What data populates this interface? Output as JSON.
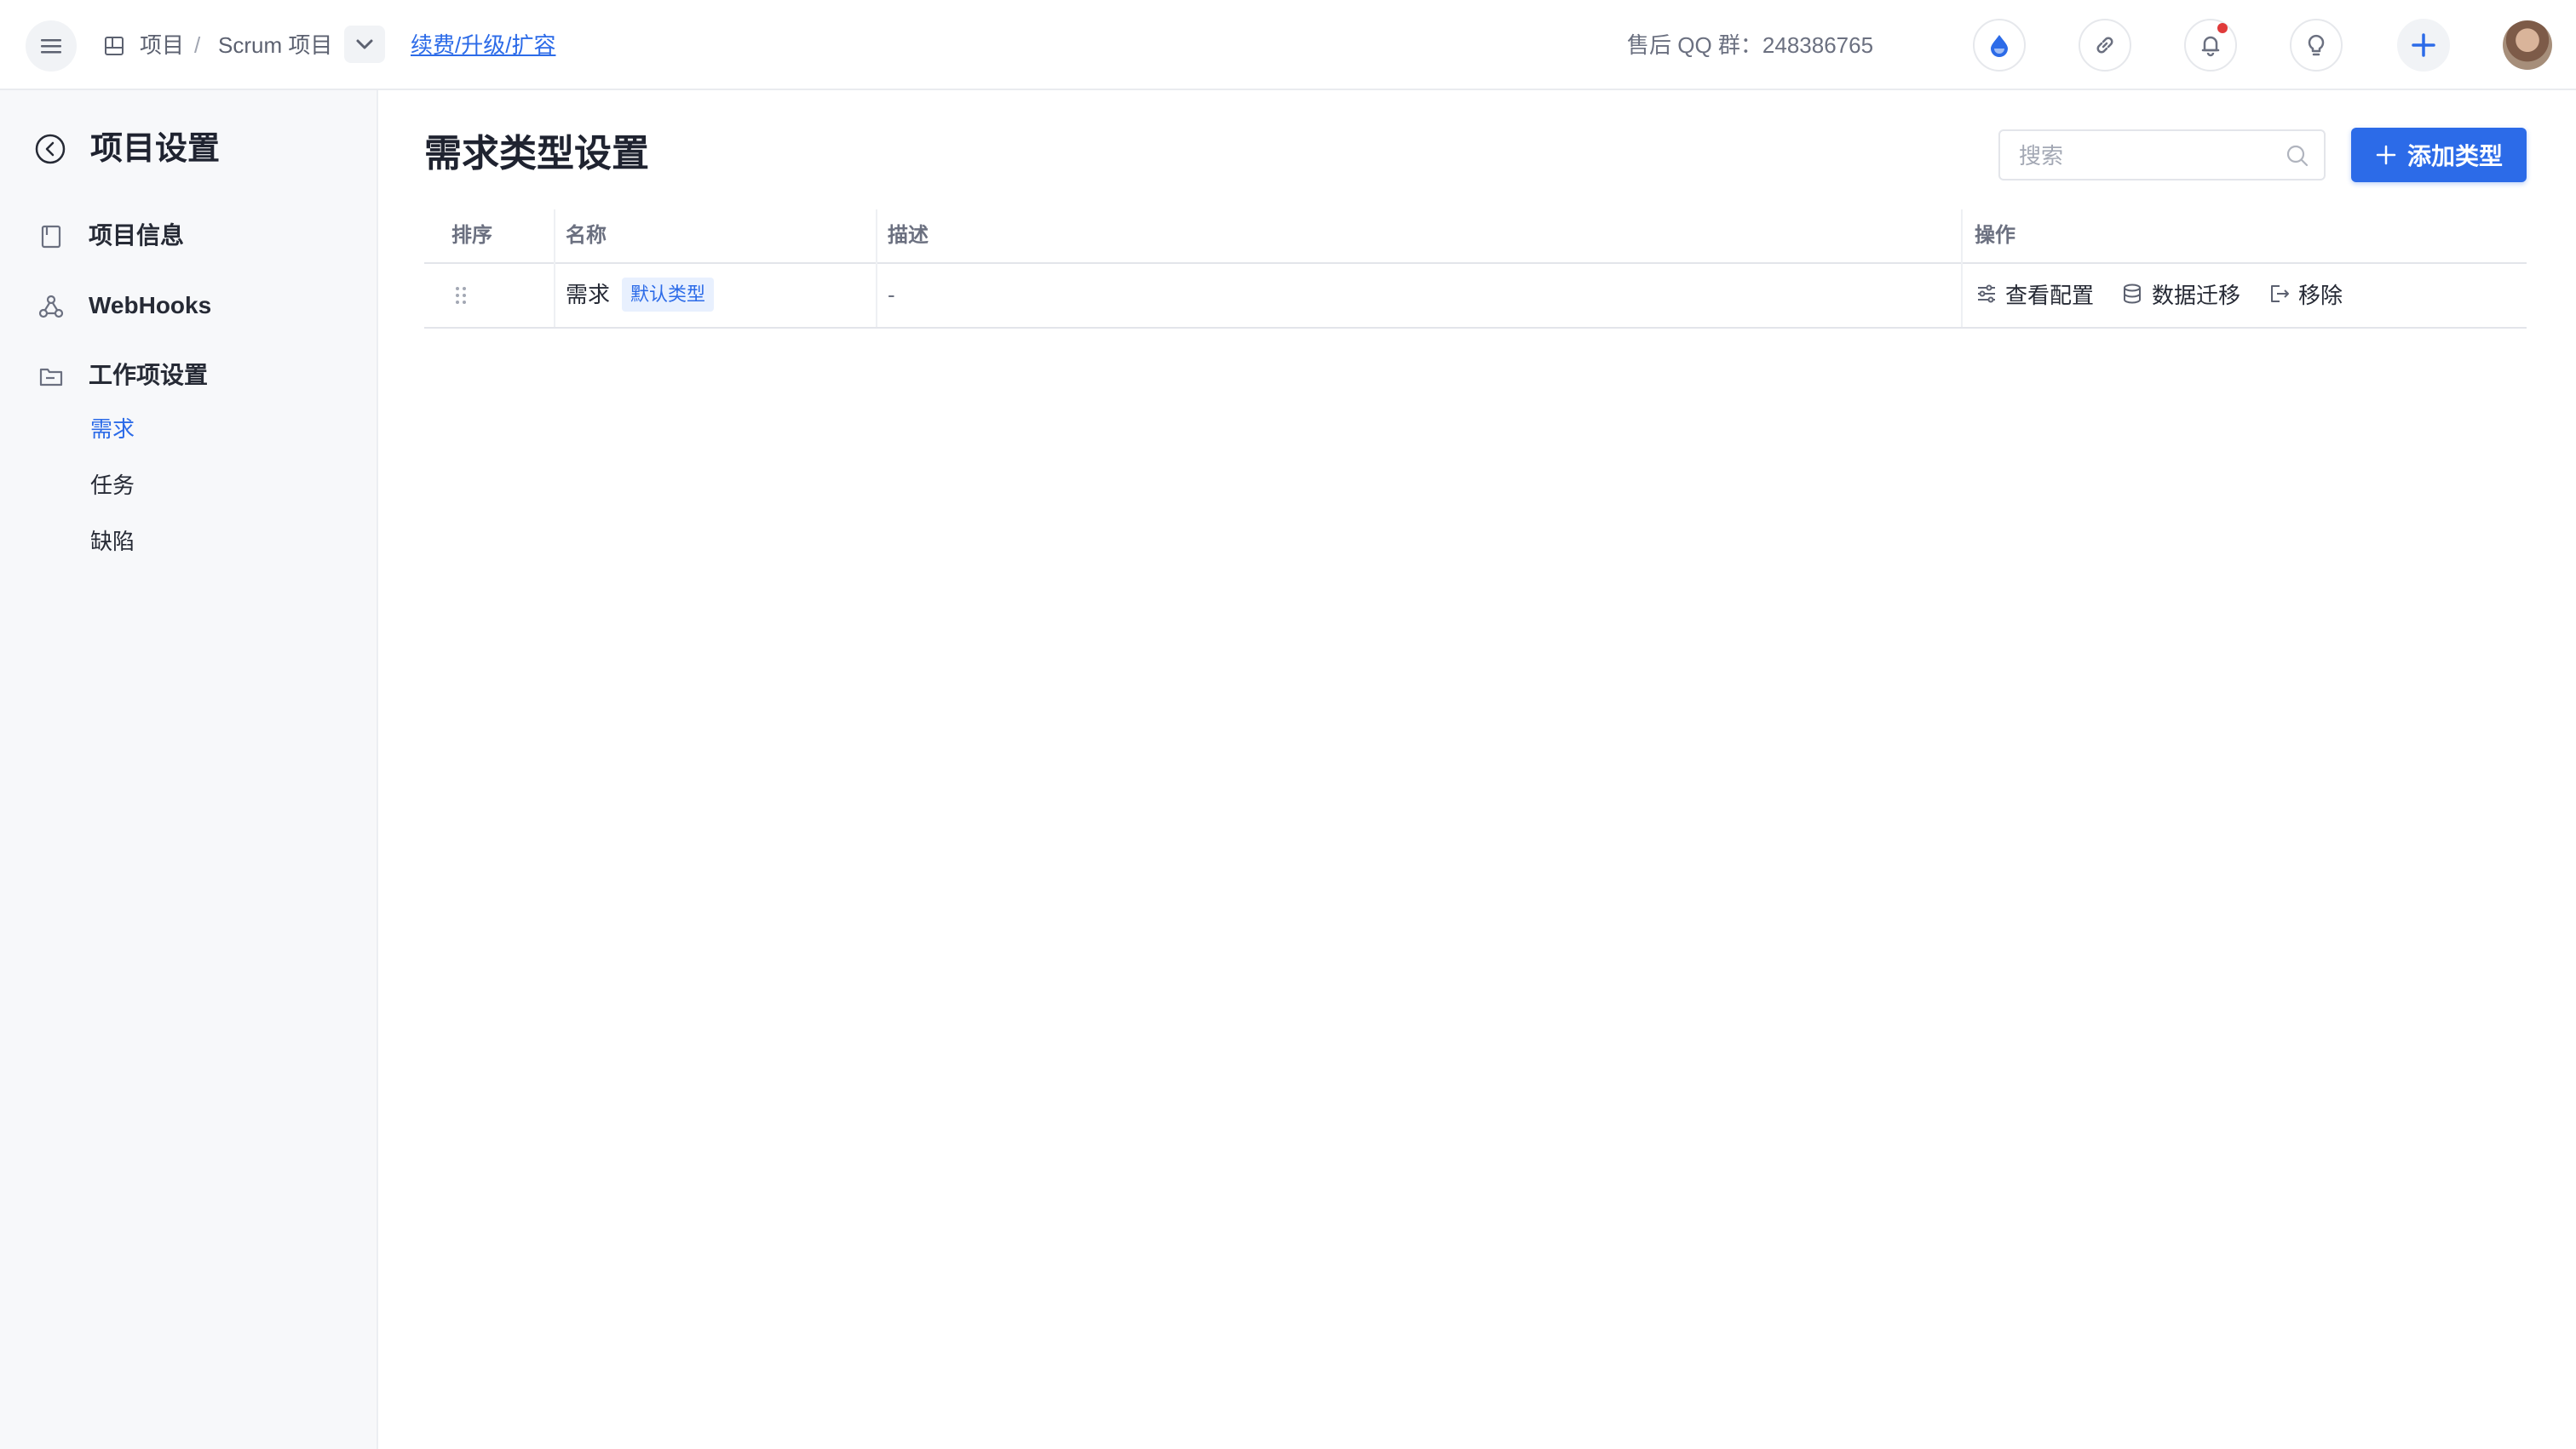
{
  "topbar": {
    "breadcrumb": {
      "item1": "项目",
      "separator": "/",
      "item2": "Scrum 项目"
    },
    "renew_link": "续费/升级/扩容",
    "qq_group": "售后 QQ 群：248386765",
    "icons": [
      "droplet-icon",
      "link-icon",
      "bell-icon",
      "lightbulb-icon",
      "plus-icon"
    ],
    "accent_color": "#2c6be8",
    "notification_dot_color": "#e03a3a"
  },
  "sidebar": {
    "title": "项目设置",
    "items": [
      {
        "label": "项目信息",
        "icon": "document-icon"
      },
      {
        "label": "WebHooks",
        "icon": "webhook-icon"
      },
      {
        "label": "工作项设置",
        "icon": "folder-icon"
      }
    ],
    "sub_items": [
      {
        "label": "需求",
        "active": true
      },
      {
        "label": "任务",
        "active": false
      },
      {
        "label": "缺陷",
        "active": false
      }
    ]
  },
  "main": {
    "title": "需求类型设置",
    "search": {
      "placeholder": "搜索",
      "value": ""
    },
    "add_button": "添加类型",
    "table": {
      "headers": [
        "排序",
        "名称",
        "描述",
        "操作"
      ],
      "rows": [
        {
          "name": "需求",
          "tag": "默认类型",
          "description": "-",
          "actions": [
            "查看配置",
            "数据迁移",
            "移除"
          ]
        }
      ]
    }
  }
}
